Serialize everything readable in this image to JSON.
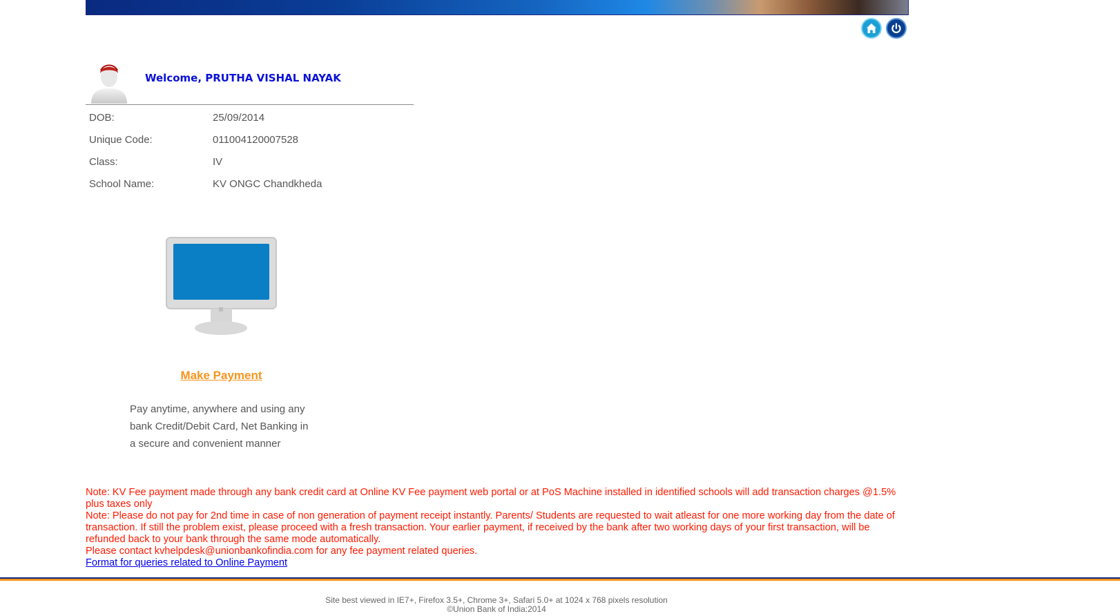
{
  "header": {
    "home_icon": "home-icon",
    "logout_icon": "power-icon"
  },
  "profile": {
    "welcome": "Welcome, PRUTHA VISHAL NAYAK",
    "fields": [
      {
        "label": "DOB:",
        "value": "25/09/2014"
      },
      {
        "label": "Unique Code:",
        "value": "011004120007528"
      },
      {
        "label": "Class:",
        "value": "IV"
      },
      {
        "label": "School Name:",
        "value": "KV ONGC Chandkheda"
      }
    ]
  },
  "payment": {
    "link_label": "Make Payment",
    "description": "Pay anytime, anywhere and using any bank Credit/Debit Card, Net Banking in a secure and convenient manner"
  },
  "notes": {
    "note1": "Note: KV Fee payment made through any bank credit card at Online KV Fee payment web portal or at PoS Machine installed in identified schools will add transaction charges @1.5% plus taxes only",
    "note2": "Note: Please do not pay for 2nd time in case of non generation of payment receipt instantly. Parents/ Students are requested to wait atleast for one more working day from the date of transaction. If still the problem exist, please proceed with a fresh transaction. Your earlier payment, if received by the bank after two working days of your first transaction, will be refunded back to your bank through the same mode automatically.",
    "contact": "Please contact kvhelpdesk@unionbankofindia.com for any fee payment related queries.",
    "queries_link": "Format for queries related to Online Payment"
  },
  "footer": {
    "best_viewed": "Site best viewed in IE7+, Firefox 3.5+, Chrome 3+, Safari 5.0+ at 1024 x 768 pixels resolution",
    "copyright": "©Union Bank of India:2014"
  },
  "colors": {
    "welcome": "#0a10d8",
    "accent_orange": "#f7941d",
    "note_red": "#ff1a00",
    "link_blue": "#0000ee"
  }
}
